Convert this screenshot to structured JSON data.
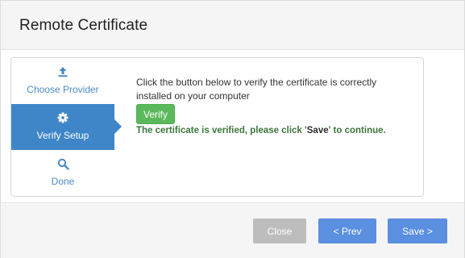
{
  "dialog": {
    "title": "Remote Certificate"
  },
  "steps": [
    {
      "label": "Choose Provider",
      "icon": "upload-icon",
      "active": false
    },
    {
      "label": "Verify Setup",
      "icon": "gear-icon",
      "active": true
    },
    {
      "label": "Done",
      "icon": "search-icon",
      "active": false
    }
  ],
  "main": {
    "instructions": "Click the button below to verify the certificate is correctly installed on your computer",
    "verify_label": "Verify",
    "verified_prefix": "The certificate is verified, please click '",
    "verified_highlight": "Save",
    "verified_suffix": "' to continue."
  },
  "footer": {
    "close_label": "Close",
    "prev_label": "< Prev",
    "save_label": "Save >"
  },
  "colors": {
    "accent": "#3f86c9",
    "step_text": "#4a8bc6",
    "success_button": "#5cb85c",
    "success_text": "#3c763d",
    "primary_button": "#5b8fe0",
    "disabled_button": "#bdbdbd"
  }
}
